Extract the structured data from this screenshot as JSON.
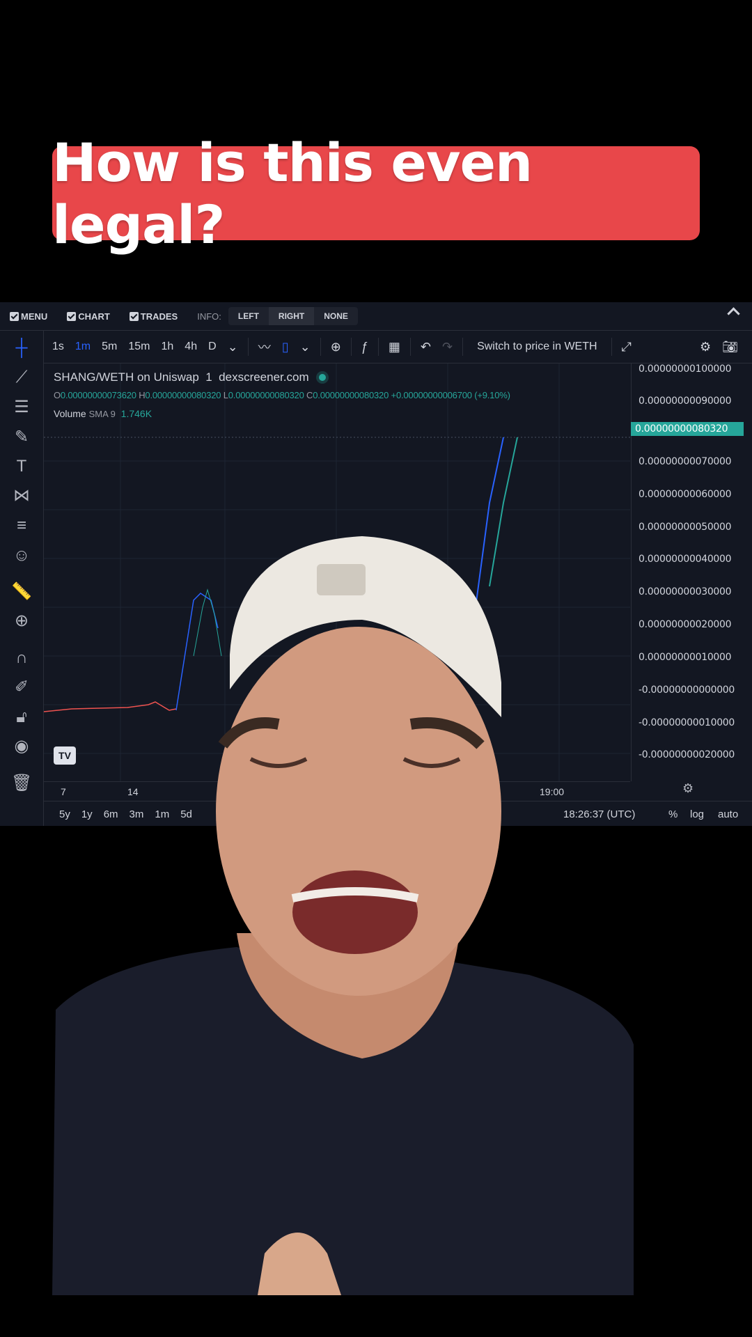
{
  "caption": {
    "text": "How is this even legal?"
  },
  "topbar": {
    "menu": "MENU",
    "chart": "CHART",
    "trades": "TRADES",
    "info_label": "INFO:",
    "info_options": [
      "LEFT",
      "RIGHT",
      "NONE"
    ],
    "info_selected": "RIGHT"
  },
  "toolbar": {
    "timeframes": [
      "1s",
      "1m",
      "5m",
      "15m",
      "1h",
      "4h",
      "D"
    ],
    "active_timeframe": "1m",
    "switch_label": "Switch to price in WETH"
  },
  "chart": {
    "symbol": "SHANG/WETH on Uniswap",
    "interval": "1",
    "source": "dexscreener.com",
    "ohlc": {
      "o_label": "O",
      "o": "0.00000000073620",
      "h_label": "H",
      "h": "0.00000000080320",
      "l_label": "L",
      "l": "0.00000000080320",
      "c_label": "C",
      "c": "0.00000000080320",
      "change": "+0.00000000006700 (+9.10%)"
    },
    "volume": {
      "label": "Volume",
      "sma": "SMA 9",
      "value": "1.746K"
    },
    "price_ticks": [
      "0.00000000100000",
      "0.00000000090000",
      "0.00000000070000",
      "0.00000000060000",
      "0.00000000050000",
      "0.00000000040000",
      "0.00000000030000",
      "0.00000000020000",
      "0.00000000010000",
      "-0.00000000000000",
      "-0.00000000010000",
      "-0.00000000020000"
    ],
    "current_price": "0.00000000080320",
    "time_ticks": [
      "7",
      "14",
      "19:00"
    ],
    "tv_logo": "TV"
  },
  "bottombar": {
    "ranges": [
      "5y",
      "1y",
      "6m",
      "3m",
      "1m",
      "5d"
    ],
    "clock": "18:26:37 (UTC)",
    "percent": "%",
    "log": "log",
    "auto": "auto"
  },
  "colors": {
    "caption_bg": "#e8474a",
    "panel_bg": "#131722",
    "up": "#26a69a",
    "accent": "#2962ff"
  }
}
